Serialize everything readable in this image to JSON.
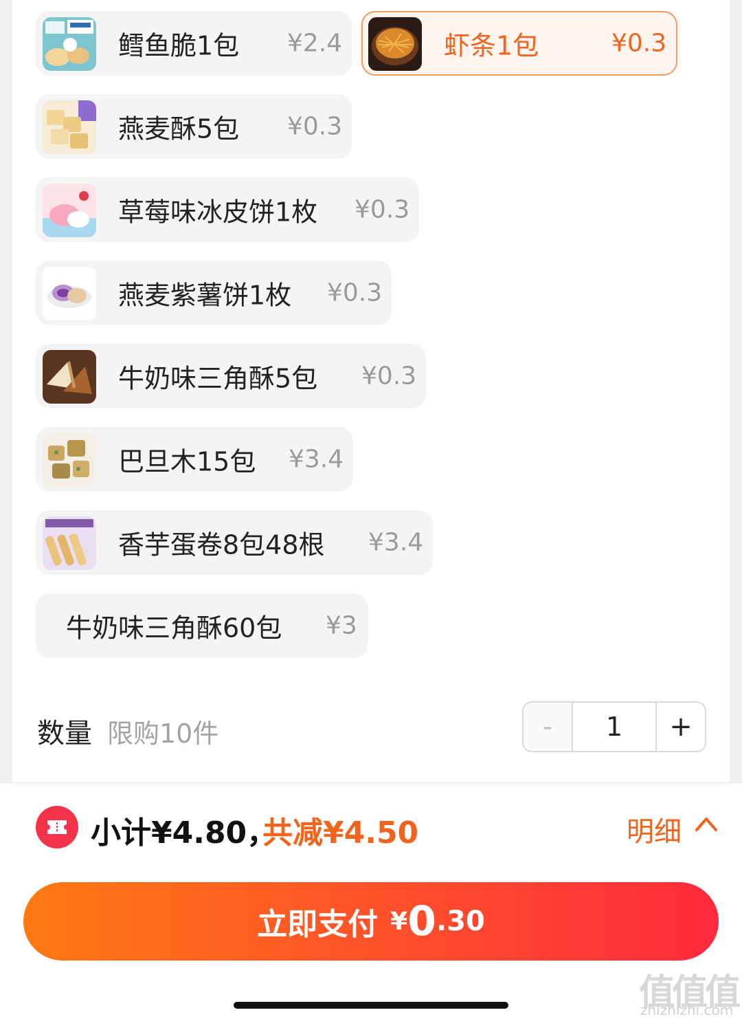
{
  "options": [
    {
      "name": "鳕鱼脆1包",
      "price": "¥2.4",
      "thumb": "cod-snack"
    },
    {
      "name": "虾条1包",
      "price": "¥0.3",
      "thumb": "shrimp-sticks",
      "selected": true
    },
    {
      "name": "燕麦酥5包",
      "price": "¥0.3",
      "thumb": "oat-crisp"
    },
    {
      "name": "草莓味冰皮饼1枚",
      "price": "¥0.3",
      "thumb": "strawberry-cake"
    },
    {
      "name": "燕麦紫薯饼1枚",
      "price": "¥0.3",
      "thumb": "purple-potato-cake"
    },
    {
      "name": "牛奶味三角酥5包",
      "price": "¥0.3",
      "thumb": "milk-triangle"
    },
    {
      "name": "巴旦木15包",
      "price": "¥3.4",
      "thumb": "almond"
    },
    {
      "name": "香芋蛋卷8包48根",
      "price": "¥3.4",
      "thumb": "taro-roll"
    },
    {
      "name": "牛奶味三角酥60包",
      "price": "¥3"
    }
  ],
  "quantity": {
    "label": "数量",
    "limit": "限购10件",
    "value": "1",
    "minus": "-",
    "plus": "+"
  },
  "summary": {
    "subtotal": "小计¥4.80，",
    "discount": "共减¥4.50",
    "detail": "明细"
  },
  "pay": {
    "label": "立即支付",
    "currency": "¥",
    "integer": "0",
    "decimal": ".30"
  },
  "watermark": {
    "logo": "值值值",
    "url": "zhizhizhi.com"
  },
  "colors": {
    "accent": "#f0641e",
    "selected_bg": "#fff4ee",
    "selected_border": "#f59a5f",
    "pay_start": "#ff7a12",
    "pay_end": "#ff2a3c"
  }
}
